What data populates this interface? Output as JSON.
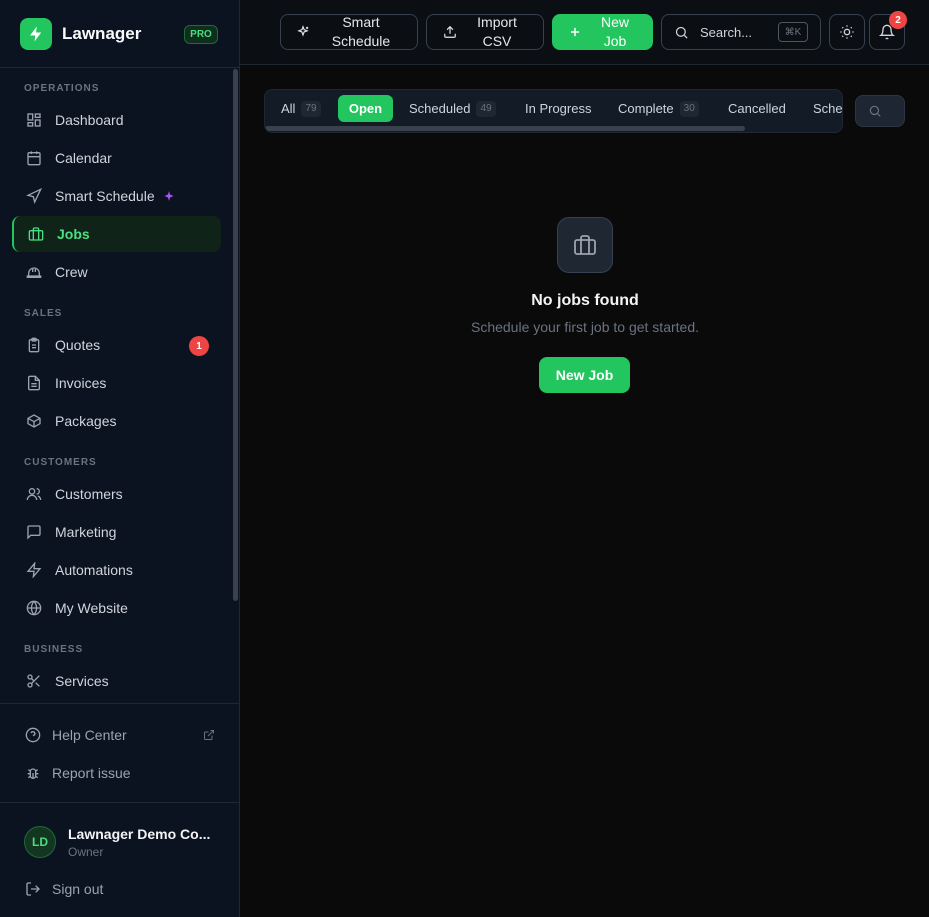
{
  "brand": {
    "name": "Lawnager",
    "plan_badge": "PRO"
  },
  "sidebar": {
    "sections": {
      "operations": "OPERATIONS",
      "sales": "SALES",
      "customers": "CUSTOMERS",
      "business": "BUSINESS"
    },
    "items": {
      "dashboard": "Dashboard",
      "calendar": "Calendar",
      "smart_schedule": "Smart Schedule",
      "jobs": "Jobs",
      "crew": "Crew",
      "quotes": "Quotes",
      "quotes_badge": "1",
      "invoices": "Invoices",
      "packages": "Packages",
      "customers": "Customers",
      "marketing": "Marketing",
      "automations": "Automations",
      "my_website": "My Website",
      "services": "Services"
    },
    "active_item": "jobs",
    "bottom": {
      "help_center": "Help Center",
      "report_issue": "Report issue"
    },
    "user": {
      "initials": "LD",
      "name": "Lawnager Demo Co...",
      "role": "Owner"
    },
    "sign_out": "Sign out"
  },
  "topbar": {
    "smart_schedule_l1": "Smart",
    "smart_schedule_l2": "Schedule",
    "import_l1": "Import",
    "import_l2": "CSV",
    "new_job_l1": "New",
    "new_job_l2": "Job",
    "search_placeholder": "Search...",
    "search_shortcut": "⌘K",
    "notifications_count": "2"
  },
  "tabs": [
    {
      "label": "All",
      "count": "79"
    },
    {
      "label": "Open",
      "count": null,
      "active": true
    },
    {
      "label": "Scheduled",
      "count": "49"
    },
    {
      "label": "In Progress",
      "count": null
    },
    {
      "label": "Complete",
      "count": "30"
    },
    {
      "label": "Cancelled",
      "count": null
    },
    {
      "label": "Sche",
      "count": null
    }
  ],
  "empty_state": {
    "title": "No jobs found",
    "subtitle": "Schedule your first job to get started.",
    "button": "New Job"
  },
  "colors": {
    "accent": "#22c55e",
    "badge": "#ef4444",
    "sparkle": "#a855f7"
  }
}
